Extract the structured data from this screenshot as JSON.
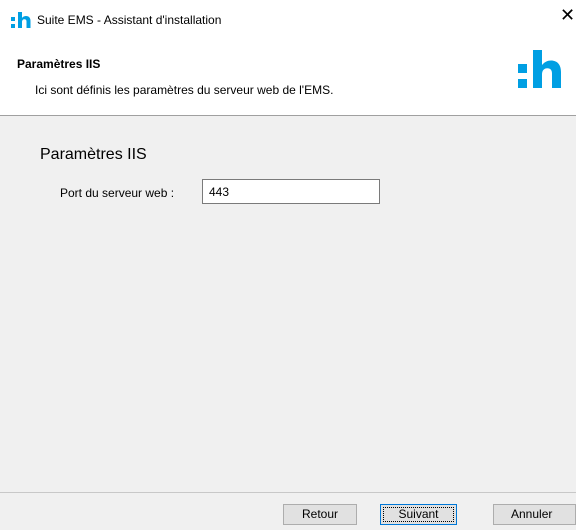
{
  "window": {
    "title": "Suite EMS - Assistant d'installation",
    "close_glyph": "✕",
    "logo_icon": "h-logo-icon"
  },
  "header": {
    "title": "Paramètres IIS",
    "subtitle": "Ici sont définis les paramètres du serveur web de l'EMS."
  },
  "main": {
    "section_title": "Paramètres IIS",
    "port_label": "Port du serveur web :",
    "port_value": "443"
  },
  "footer": {
    "back_label": "Retour",
    "next_label": "Suivant",
    "cancel_label": "Annuler"
  },
  "colors": {
    "brand": "#009fe3",
    "window_bg": "#f0f0f0",
    "focus_border": "#0078d7"
  }
}
